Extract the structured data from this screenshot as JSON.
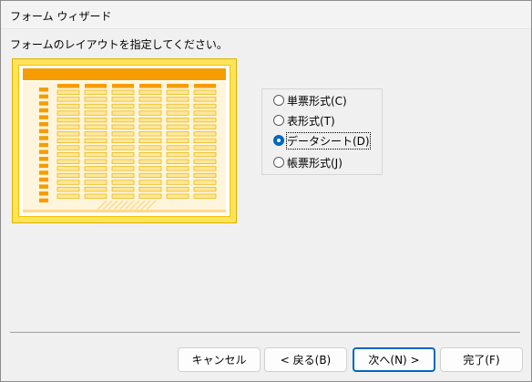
{
  "window": {
    "title": "フォーム ウィザード"
  },
  "instruction": "フォームのレイアウトを指定してください。",
  "layout_options": [
    {
      "label": "単票形式(C)",
      "checked": false
    },
    {
      "label": "表形式(T)",
      "checked": false
    },
    {
      "label": "データシート(D)",
      "checked": true
    },
    {
      "label": "帳票形式(J)",
      "checked": false
    }
  ],
  "preview": {
    "icon": "datasheet-preview",
    "accent": "#f59d00",
    "fill": "#ffe35a"
  },
  "buttons": {
    "cancel": "キャンセル",
    "back": "< 戻る(B)",
    "next": "次へ(N) >",
    "finish": "完了(F)"
  },
  "colors": {
    "accent": "#0067c0"
  }
}
